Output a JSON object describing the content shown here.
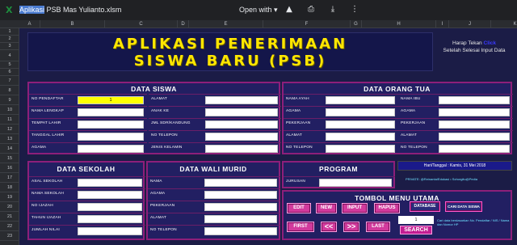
{
  "topbar": {
    "app_icon": "excel-icon",
    "filename_highlight": "Aplikasi",
    "filename_rest": " PSB Mas Yulianto.xlsm",
    "open_with": "Open with",
    "open_with_caret": "▾",
    "icons": [
      "google-drive-icon",
      "print-icon",
      "download-icon",
      "more-icon"
    ]
  },
  "columns": [
    "A",
    "B",
    "C",
    "D",
    "E",
    "F",
    "G",
    "H",
    "I",
    "J",
    "K",
    "L",
    "M"
  ],
  "rows": [
    "1",
    "2",
    "3",
    "4",
    "5",
    "6",
    "7",
    "8",
    "9",
    "10",
    "11",
    "12",
    "13",
    "14",
    "15",
    "16",
    "17",
    "18",
    "19",
    "20",
    "21",
    "22",
    "23",
    "24",
    "25",
    "26",
    "27",
    "28",
    "29",
    "30",
    "31",
    "32",
    "33",
    "34",
    "35"
  ],
  "banner": {
    "line1": "APLIKASI PENERIMAAN",
    "line2": "SISWA BARU (PSB)"
  },
  "side_note": {
    "pre": "Harap Tekan",
    "click": "Click",
    "post": "Setelah Selesai Input Data"
  },
  "data_siswa": {
    "title": "DATA SISWA",
    "left": [
      {
        "label": "NO PENDAFTAR",
        "value": "1",
        "highlight": true
      },
      {
        "label": "NAMA LENGKAP",
        "value": ""
      },
      {
        "label": "TEMPAT LAHIR",
        "value": ""
      },
      {
        "label": "TANGGAL LAHIR",
        "value": ""
      },
      {
        "label": "AGAMA",
        "value": ""
      }
    ],
    "right": [
      {
        "label": "ALAMAT",
        "value": ""
      },
      {
        "label": "ANAK KE",
        "value": ""
      },
      {
        "label": "JML SDR/KANDUNG",
        "value": ""
      },
      {
        "label": "NO TELEPON",
        "value": ""
      },
      {
        "label": "JENIS KELAMIN",
        "value": ""
      }
    ]
  },
  "data_orang_tua": {
    "title": "DATA ORANG TUA",
    "left": [
      {
        "label": "NAMA AYAH",
        "value": ""
      },
      {
        "label": "AGAMA",
        "value": ""
      },
      {
        "label": "PEKERJAAN",
        "value": ""
      },
      {
        "label": "ALAMAT",
        "value": ""
      },
      {
        "label": "NO TELEPON",
        "value": ""
      }
    ],
    "right": [
      {
        "label": "NAMA IBU",
        "value": ""
      },
      {
        "label": "AGAMA",
        "value": ""
      },
      {
        "label": "PEKERJAAN",
        "value": ""
      },
      {
        "label": "ALAMAT",
        "value": ""
      },
      {
        "label": "NO TELEPON",
        "value": ""
      }
    ]
  },
  "data_sekolah": {
    "title": "DATA SEKOLAH",
    "rows": [
      {
        "label": "ASAL SEKOLAH",
        "value": ""
      },
      {
        "label": "NAMA SEKOLAH",
        "value": ""
      },
      {
        "label": "NO IJAZAH",
        "value": ""
      },
      {
        "label": "TAHUN IJAZAH",
        "value": ""
      },
      {
        "label": "JUMLAH NILAI",
        "value": ""
      }
    ]
  },
  "data_wali": {
    "title": "DATA WALI MURID",
    "rows": [
      {
        "label": "NAMA",
        "value": ""
      },
      {
        "label": "AGAMA",
        "value": ""
      },
      {
        "label": "PEKERJAAN",
        "value": ""
      },
      {
        "label": "ALAMAT",
        "value": ""
      },
      {
        "label": "NO TELEPON",
        "value": ""
      }
    ]
  },
  "program": {
    "title": "PROGRAM",
    "rows": [
      {
        "label": "JURUSAN",
        "value": ""
      }
    ]
  },
  "hari_tanggal": "Hari/Tanggal : Kamis, 31 Mei 2018",
  "credit": "PRIVATE: @Reinanta/Edukasi • Schorgitu@Pedia",
  "menu": {
    "title": "TOMBOL MENU UTAMA",
    "buttons": [
      "EDIT",
      "NEW",
      "INPUT",
      "HAPUS",
      "DATABASE",
      "CARI DATA SISWA"
    ],
    "nav": [
      "FIRST",
      "<<",
      ">>",
      "LAST"
    ],
    "search_value": "1",
    "search_label": "SEARCH",
    "note": "Cari data berdasarkan No. Pendaftar / NIS / Nama dan Nomor HP"
  }
}
